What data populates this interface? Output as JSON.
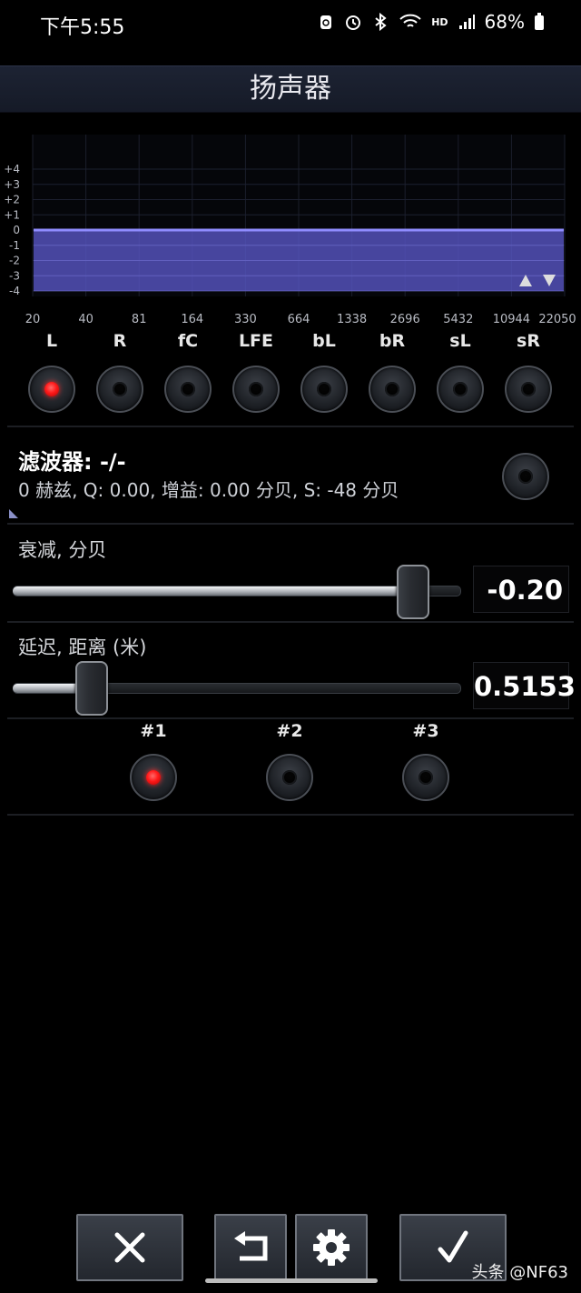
{
  "status_bar": {
    "time": "下午5:55",
    "network_type": "HD",
    "battery": "68%",
    "icons": [
      "recycle-icon",
      "alarm-icon",
      "bluetooth-icon",
      "wifi-icon",
      "signal-icon",
      "battery-icon"
    ]
  },
  "title": "扬声器",
  "eq": {
    "y_ticks": [
      "+4",
      "+3",
      "+2",
      "+1",
      "0",
      "-1",
      "-2",
      "-3",
      "-4"
    ],
    "x_ticks": [
      "20",
      "40",
      "81",
      "164",
      "330",
      "664",
      "1338",
      "2696",
      "5432",
      "10944",
      "22050"
    ],
    "y_range": [
      -4,
      4
    ],
    "current_level": 0,
    "accent_color": "#5a57c8",
    "scroll_icons": [
      "arrow-up-icon",
      "arrow-down-icon"
    ]
  },
  "channels": [
    {
      "label": "L",
      "active": true
    },
    {
      "label": "R",
      "active": false
    },
    {
      "label": "fC",
      "active": false
    },
    {
      "label": "LFE",
      "active": false
    },
    {
      "label": "bL",
      "active": false
    },
    {
      "label": "bR",
      "active": false
    },
    {
      "label": "sL",
      "active": false
    },
    {
      "label": "sR",
      "active": false
    }
  ],
  "filter": {
    "title": "滤波器: -/-",
    "info": "0 赫兹, Q: 0.00, 增益: 0.00 分贝, S: -48 分贝"
  },
  "attenuation": {
    "label": "衰减, 分贝",
    "value": "-0.20",
    "position_fraction": 0.92
  },
  "delay": {
    "label": "延迟, 距离 (米)",
    "value": "0.5153",
    "position_fraction": 0.15
  },
  "presets": [
    {
      "label": "#1",
      "active": true
    },
    {
      "label": "#2",
      "active": false
    },
    {
      "label": "#3",
      "active": false
    }
  ],
  "bottom_buttons": [
    "close-icon",
    "undo-icon",
    "gear-icon",
    "check-icon"
  ],
  "watermark": "头条 @NF63"
}
